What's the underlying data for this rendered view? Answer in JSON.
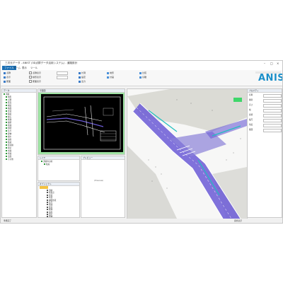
{
  "window": {
    "title": "三次元データ - ANIST (3D点群データ活用システム) - 道路設計"
  },
  "menu": [
    {
      "label": "ファイル"
    },
    {
      "label": "ホーム"
    },
    {
      "label": "表示"
    },
    {
      "label": "ツール"
    }
  ],
  "ribbon": {
    "groups": [
      {
        "label": "点群"
      },
      {
        "label": "表示"
      },
      {
        "label": "断面"
      },
      {
        "label": "計測"
      },
      {
        "label": "設定"
      },
      {
        "label": "出力"
      }
    ],
    "checkboxes": [
      {
        "label": "点群表示"
      },
      {
        "label": "線形表示"
      },
      {
        "label": "断面表示"
      }
    ],
    "dropdowns": [
      {
        "value": ""
      },
      {
        "value": ""
      }
    ],
    "right_buttons": [
      {
        "label": "地形"
      },
      {
        "label": "計画"
      },
      {
        "label": "比較"
      },
      {
        "label": "鳥瞰"
      }
    ]
  },
  "logo": {
    "text": "ANIST"
  },
  "tree": {
    "header": "データ",
    "items": [
      "道路",
      "地形",
      "点群",
      "区画",
      "構造",
      "路面",
      "歩道",
      "舗装",
      "縁石",
      "側溝",
      "擁壁",
      "標識",
      "照明",
      "信号",
      "建物",
      "樹木",
      "電柱",
      "植栽",
      "区画線",
      "標示",
      "水路",
      "管路",
      "法面",
      "その他"
    ]
  },
  "plan": {
    "header": "平面図"
  },
  "layers": {
    "header": "レイヤ",
    "items": [
      "道路中心線",
      "幅員"
    ]
  },
  "objects": {
    "header": "オブジェクト",
    "items": [
      "道路",
      "交差点",
      "歩道",
      "車道",
      "横断歩道",
      "信号",
      "標識",
      "区画",
      "側溝",
      "電柱",
      "街灯",
      "建物"
    ]
  },
  "preview": {
    "header": "プレビュー",
    "note": "(Preview)"
  },
  "view3d": {
    "label": "3Dビュー"
  },
  "properties": {
    "header": "プロパティ",
    "rows": [
      {
        "label": "名称",
        "value": ""
      },
      {
        "label": "種別",
        "value": ""
      },
      {
        "label": "高さ",
        "value": ""
      },
      {
        "label": "幅",
        "value": ""
      },
      {
        "label": "座標",
        "value": ""
      },
      {
        "label": "縮尺",
        "value": ""
      },
      {
        "label": "角度",
        "value": ""
      },
      {
        "label": "範囲",
        "value": ""
      }
    ]
  },
  "status": {
    "left": "準備完了",
    "right": "座標表示"
  },
  "colors": {
    "accent": "#1b6fb3",
    "logo": "#1c8fc9",
    "plan_bg": "#000000",
    "plan_frame": "#9ee3a3",
    "road": "#6b5bd6"
  }
}
